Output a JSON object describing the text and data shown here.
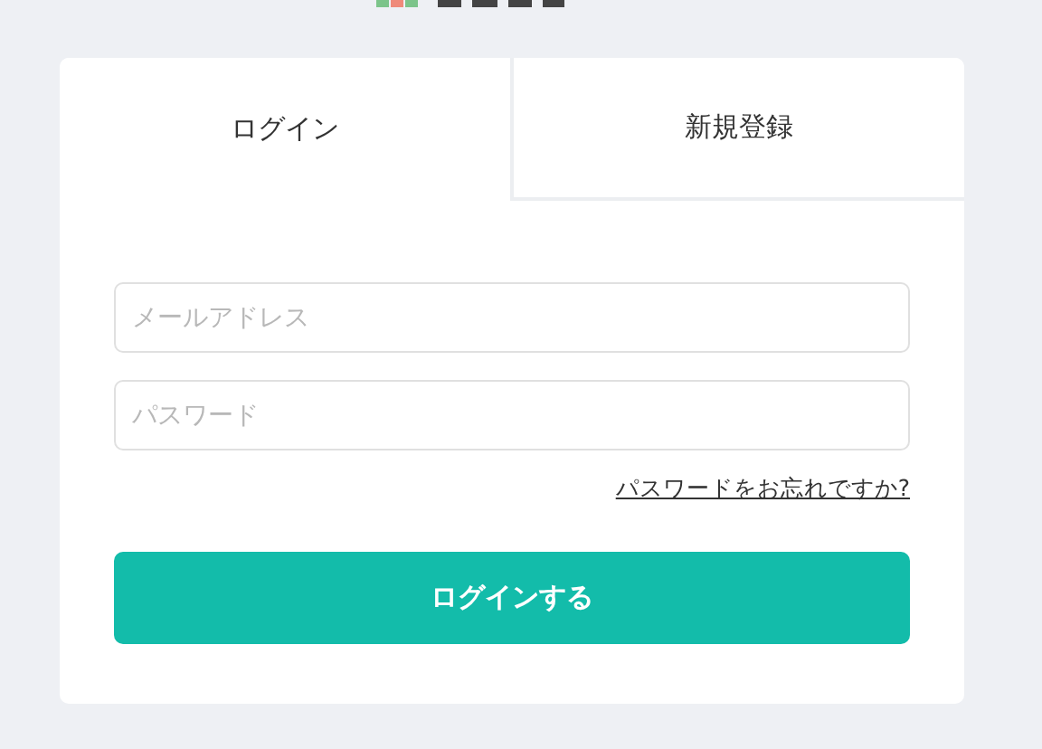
{
  "tabs": [
    {
      "label": "ログイン",
      "selected": true
    },
    {
      "label": "新規登録",
      "selected": false
    }
  ],
  "fields": [
    {
      "placeholder": "メールアドレス"
    },
    {
      "placeholder": "パスワード"
    }
  ],
  "forgot_link": "パスワードをお忘れですか?",
  "submit_button": "ログインする"
}
